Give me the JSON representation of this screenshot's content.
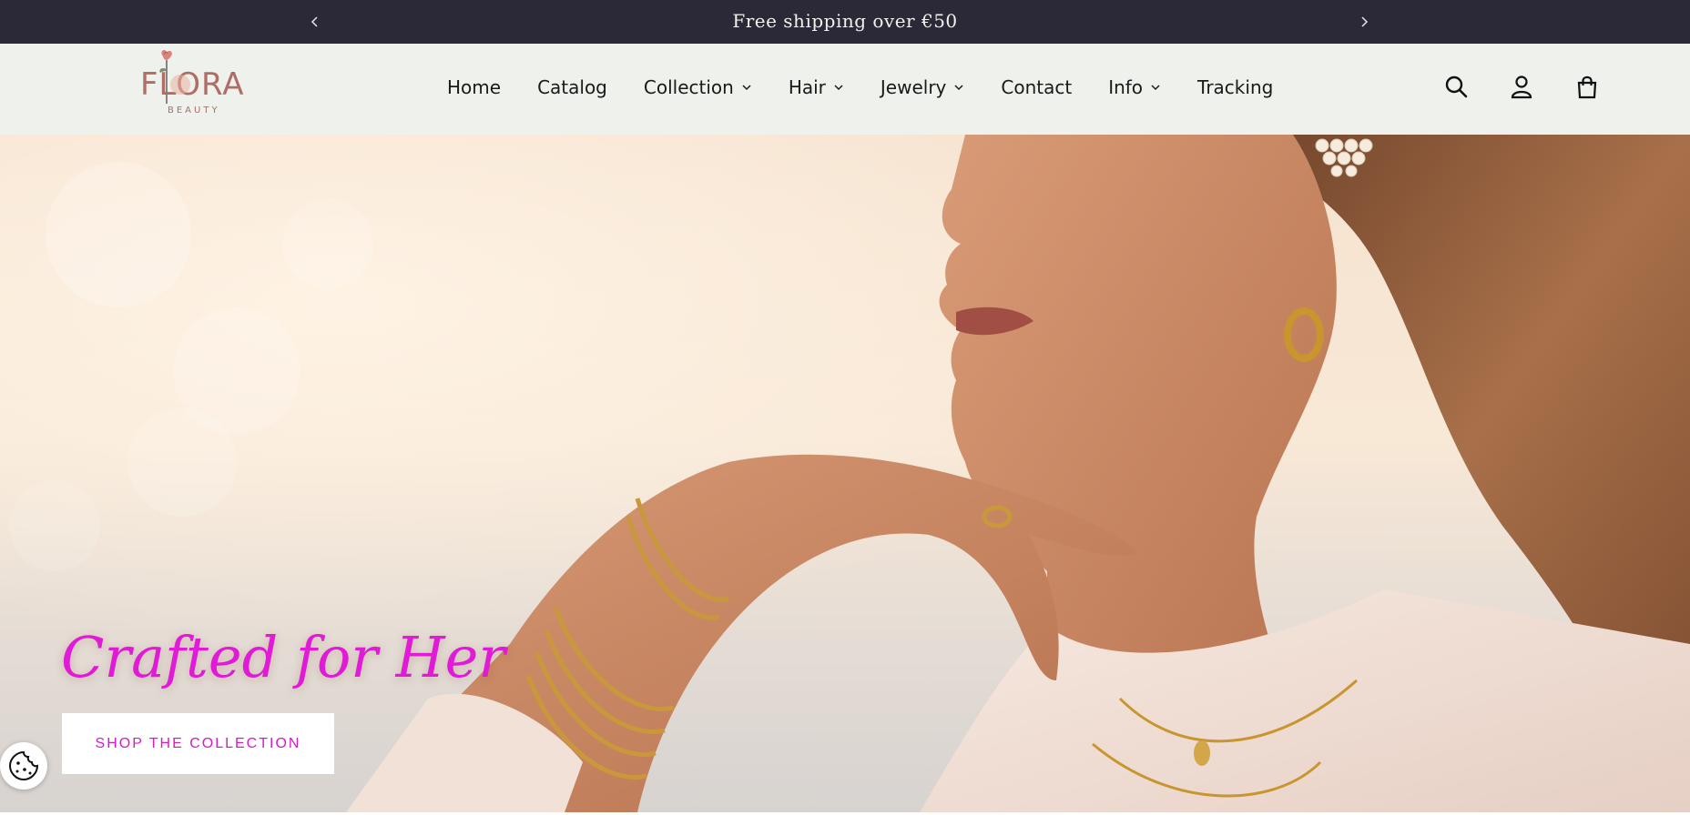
{
  "announcement": {
    "text": "Free shipping over €50",
    "prev_icon": "chevron-left-icon",
    "next_icon": "chevron-right-icon"
  },
  "logo": {
    "text": "FLORA",
    "subtext": "BEAUTY"
  },
  "nav": {
    "items": [
      {
        "label": "Home",
        "has_dropdown": false
      },
      {
        "label": "Catalog",
        "has_dropdown": false
      },
      {
        "label": "Collection",
        "has_dropdown": true
      },
      {
        "label": "Hair",
        "has_dropdown": true
      },
      {
        "label": "Jewelry",
        "has_dropdown": true
      },
      {
        "label": "Contact",
        "has_dropdown": false
      },
      {
        "label": "Info",
        "has_dropdown": true
      },
      {
        "label": "Tracking",
        "has_dropdown": false
      }
    ]
  },
  "header_icons": [
    "search-icon",
    "account-icon",
    "cart-icon"
  ],
  "hero": {
    "title": "Crafted for Her",
    "button_label": "SHOP THE COLLECTION"
  },
  "colors": {
    "announcement_bg": "#2b2838",
    "header_bg": "#eef1ec",
    "accent": "#e01ad6"
  },
  "cookie": {
    "icon": "cookie-icon"
  }
}
